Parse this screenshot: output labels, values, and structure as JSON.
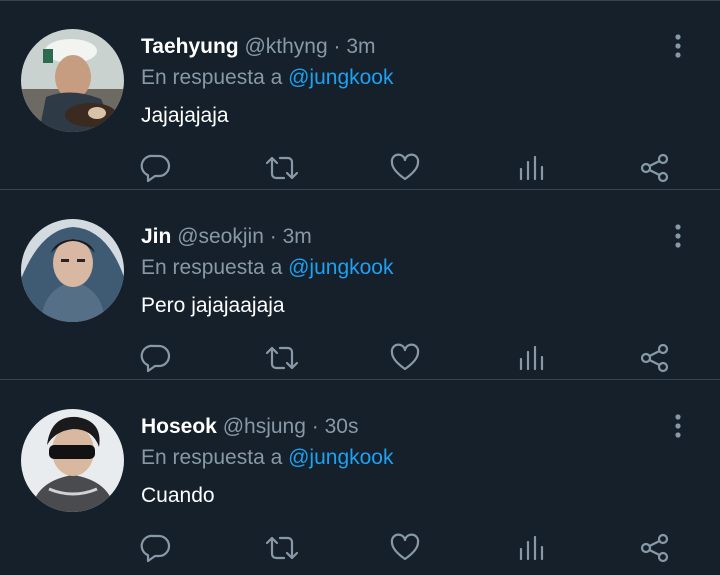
{
  "tweets": [
    {
      "name": "Taehyung",
      "handle": "@kthyng",
      "separator": "·",
      "time": "3m",
      "reply_prefix": "En respuesta a",
      "reply_to": "@jungkook",
      "text": "Jajajajaja"
    },
    {
      "name": "Jin",
      "handle": "@seokjin",
      "separator": "·",
      "time": "3m",
      "reply_prefix": "En respuesta a",
      "reply_to": "@jungkook",
      "text": "Pero jajajaajaja"
    },
    {
      "name": "Hoseok",
      "handle": "@hsjung",
      "separator": "·",
      "time": "30s",
      "reply_prefix": "En respuesta a",
      "reply_to": "@jungkook",
      "text": "Cuando"
    }
  ],
  "icons": {
    "reply": "reply-icon",
    "retweet": "retweet-icon",
    "like": "heart-icon",
    "stats": "stats-icon",
    "share": "share-icon",
    "more": "more-vertical-icon"
  },
  "colors": {
    "background": "#15202b",
    "divider": "#38444d",
    "secondary_text": "#8899a6",
    "mention": "#1da1f2",
    "primary_text": "#ffffff"
  }
}
